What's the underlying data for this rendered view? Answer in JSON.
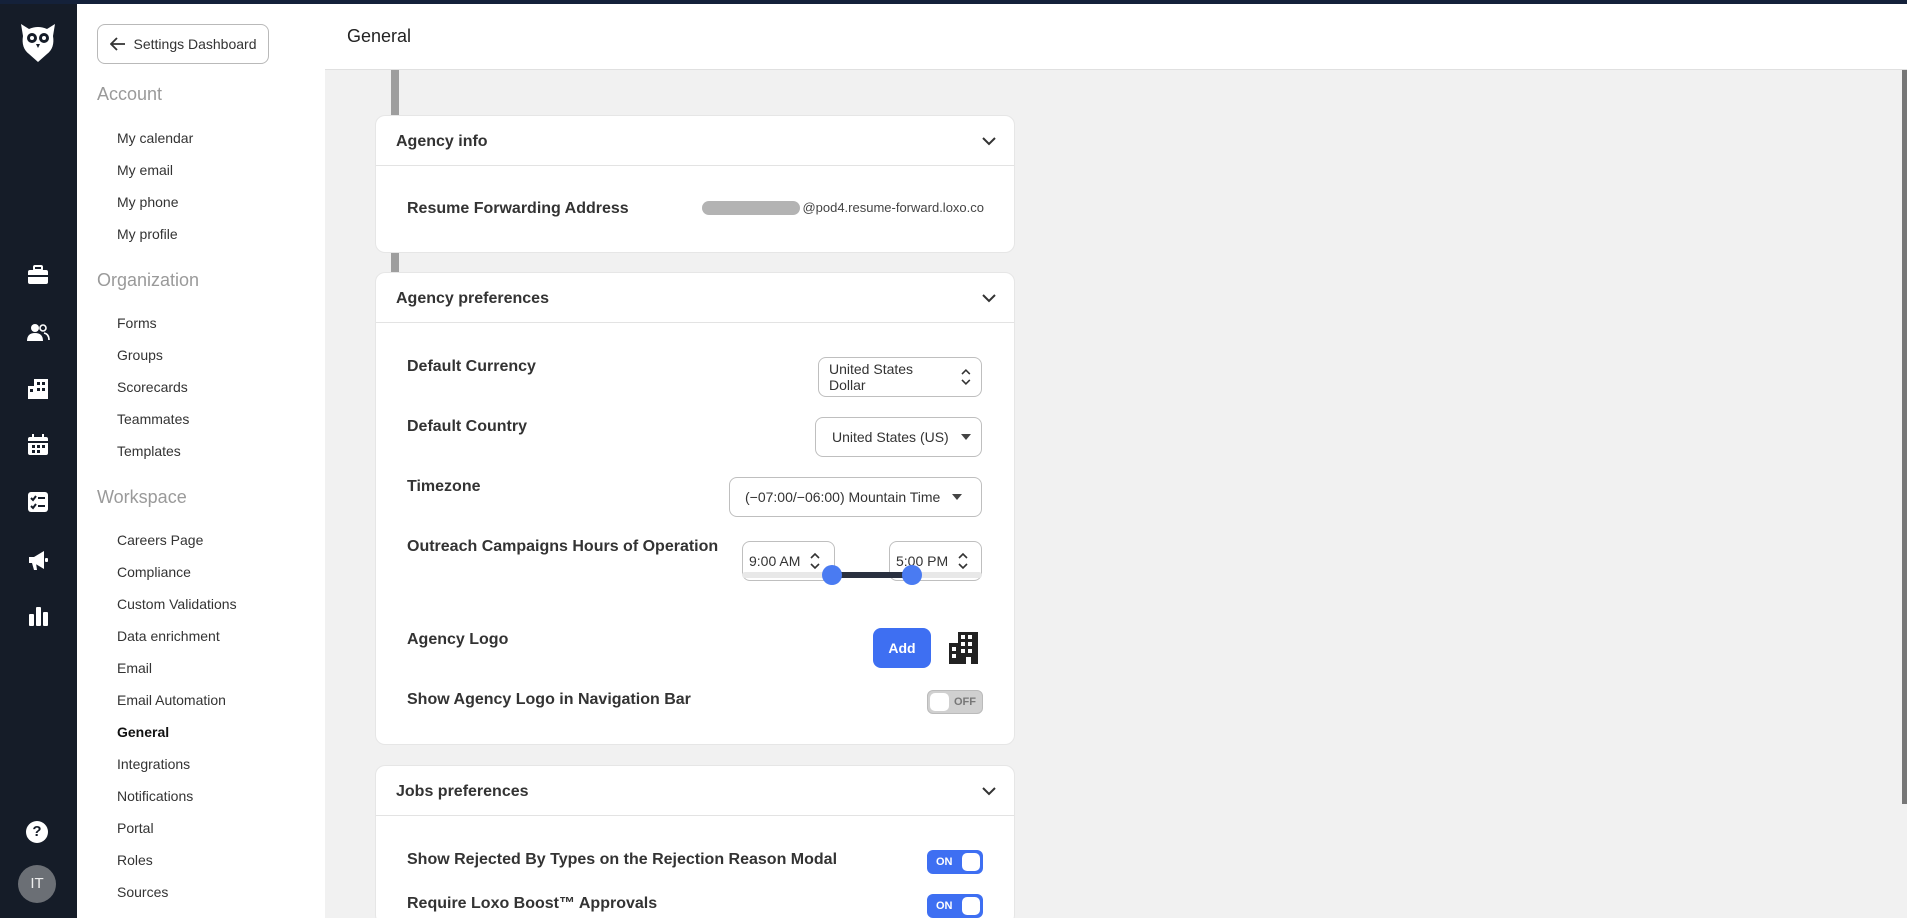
{
  "app": {
    "accent_color": "#3e6ff2",
    "rail_color": "#151c28"
  },
  "rail": {
    "icons": [
      "owl-logo-icon",
      "briefcase-icon",
      "people-icon",
      "building-icon",
      "calendar-icon",
      "checklist-icon",
      "megaphone-icon",
      "bar-chart-icon"
    ],
    "help_label": "?",
    "avatar_initials": "IT"
  },
  "sidebar": {
    "back_label": "Settings Dashboard",
    "sections": {
      "account": {
        "title": "Account",
        "items": [
          "My calendar",
          "My email",
          "My phone",
          "My profile"
        ]
      },
      "organization": {
        "title": "Organization",
        "items": [
          "Forms",
          "Groups",
          "Scorecards",
          "Teammates",
          "Templates"
        ]
      },
      "workspace": {
        "title": "Workspace",
        "items": [
          "Careers Page",
          "Compliance",
          "Custom Validations",
          "Data enrichment",
          "Email",
          "Email Automation",
          "General",
          "Integrations",
          "Notifications",
          "Portal",
          "Roles",
          "Sources"
        ]
      }
    },
    "active_item": "General"
  },
  "header": {
    "title": "General"
  },
  "agency_info": {
    "title": "Agency info",
    "resume_label": "Resume Forwarding Address",
    "resume_domain": "@pod4.resume-forward.loxo.co"
  },
  "agency_preferences": {
    "title": "Agency preferences",
    "currency_label": "Default Currency",
    "currency_value": "United States Dollar",
    "country_label": "Default Country",
    "country_value": "United States (US)",
    "timezone_label": "Timezone",
    "timezone_value": "(−07:00/−06:00) Mountain Time",
    "hours_label": "Outreach Campaigns Hours of Operation",
    "hours_start": "9:00 AM",
    "hours_end": "5:00 PM",
    "hours_range_fraction": [
      0.375,
      0.708
    ],
    "logo_label": "Agency Logo",
    "logo_add_label": "Add",
    "show_logo_label": "Show Agency Logo in Navigation Bar",
    "show_logo_state": "OFF"
  },
  "jobs_preferences": {
    "title": "Jobs preferences",
    "rejected_label": "Show Rejected By Types on the Rejection Reason Modal",
    "rejected_state": "ON",
    "boost_label": "Require Loxo Boost™ Approvals",
    "boost_state": "ON"
  }
}
